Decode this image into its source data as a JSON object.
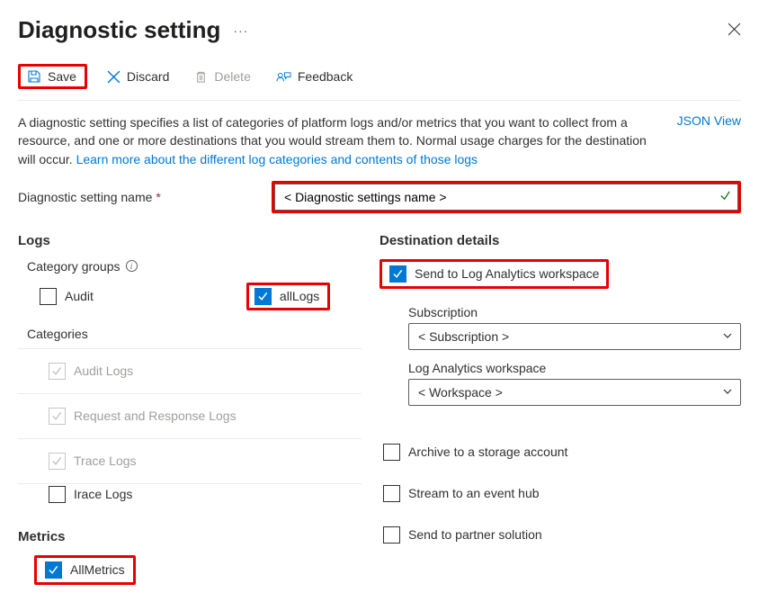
{
  "header": {
    "title": "Diagnostic setting"
  },
  "toolbar": {
    "save": "Save",
    "discard": "Discard",
    "delete": "Delete",
    "feedback": "Feedback"
  },
  "description": {
    "text1": "A diagnostic setting specifies a list of categories of platform logs and/or metrics that you want to collect from a resource, and one or more destinations that you would stream them to. Normal usage charges for the destination will occur. ",
    "link": "Learn more about the different log categories and contents of those logs",
    "json_view": "JSON View"
  },
  "name_field": {
    "label": "Diagnostic setting name",
    "value": "< Diagnostic settings name >"
  },
  "logs": {
    "heading": "Logs",
    "category_groups_label": "Category groups",
    "audit": "Audit",
    "all_logs": "allLogs",
    "categories_label": "Categories",
    "audit_logs": "Audit Logs",
    "request_response": "Request and Response Logs",
    "trace_logs": "Trace Logs",
    "trace_logs2": "Irace Logs"
  },
  "metrics": {
    "heading": "Metrics",
    "all_metrics": "AllMetrics"
  },
  "destination": {
    "heading": "Destination details",
    "send_law": "Send to Log Analytics workspace",
    "subscription_label": "Subscription",
    "subscription_value": "< Subscription >",
    "workspace_label": "Log Analytics workspace",
    "workspace_value": "< Workspace >",
    "archive_storage": "Archive to a storage account",
    "stream_eventhub": "Stream to an event hub",
    "partner_solution": "Send to partner solution"
  }
}
